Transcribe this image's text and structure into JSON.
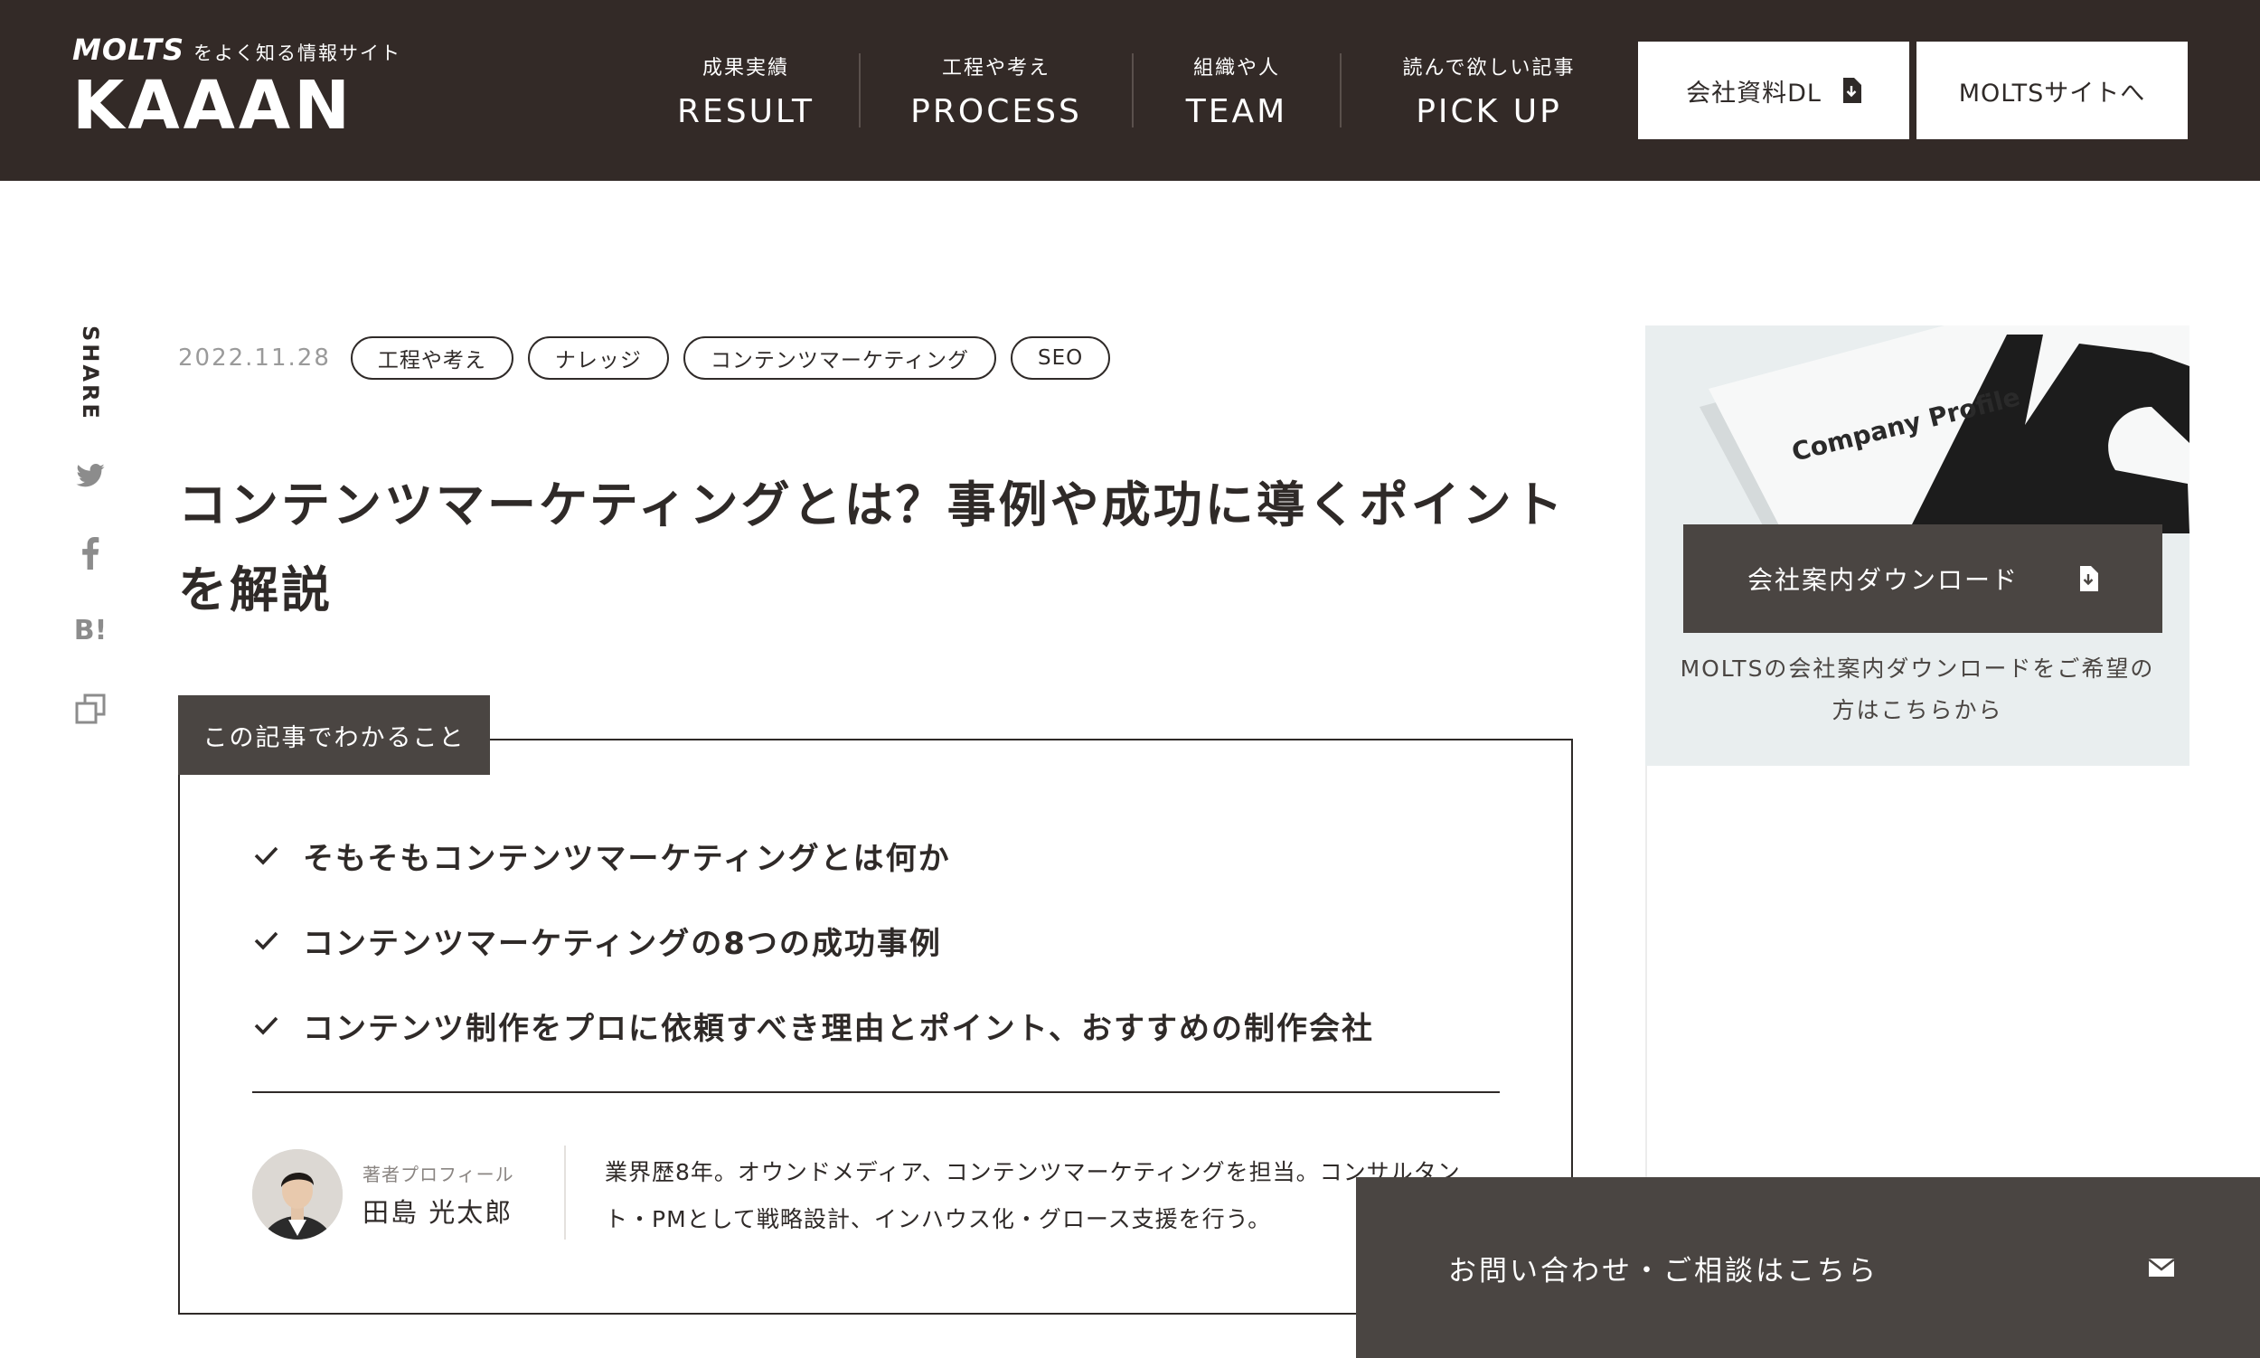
{
  "header": {
    "logo_brand": "MOLTS",
    "logo_tagline": "をよく知る情報サイト",
    "logo_main": "KAAAN",
    "nav": [
      {
        "jp": "成果実績",
        "en": "RESULT"
      },
      {
        "jp": "工程や考え",
        "en": "PROCESS"
      },
      {
        "jp": "組織や人",
        "en": "TEAM"
      },
      {
        "jp": "読んで欲しい記事",
        "en": "PICK UP"
      }
    ],
    "download_button": "会社資料DL",
    "site_button": "MOLTSサイトへ",
    "background_color": "#332a27"
  },
  "share": {
    "label": "SHARE",
    "icons": [
      "twitter-icon",
      "facebook-icon",
      "hatena-bookmark-icon",
      "copy-link-icon"
    ],
    "hatena_text": "B!"
  },
  "article": {
    "date": "2022.11.28",
    "tags": [
      "工程や考え",
      "ナレッジ",
      "コンテンツマーケティング",
      "SEO"
    ],
    "title": "コンテンツマーケティングとは？事例や成功に導くポイントを解説"
  },
  "summary": {
    "label": "この記事でわかること",
    "points": [
      "そもそもコンテンツマーケティングとは何か",
      "コンテンツマーケティングの8つの成功事例",
      "コンテンツ制作をプロに依頼すべき理由とポイント、おすすめの制作会社"
    ],
    "author_role": "著者プロフィール",
    "author_name": "田島 光太郎",
    "author_bio": "業界歴8年。オウンドメディア、コンテンツマーケティングを担当。コンサルタント・PMとして戦略設計、インハウス化・グロース支援を行う。"
  },
  "sidebar": {
    "art_text": "Company Profile",
    "download_button": "会社案内ダウンロード",
    "caption": "MOLTSの会社案内ダウンロードをご希望の方はこちらから"
  },
  "contact": {
    "label": "お問い合わせ・ご相談はこちら",
    "accent_color": "#4a4542"
  }
}
